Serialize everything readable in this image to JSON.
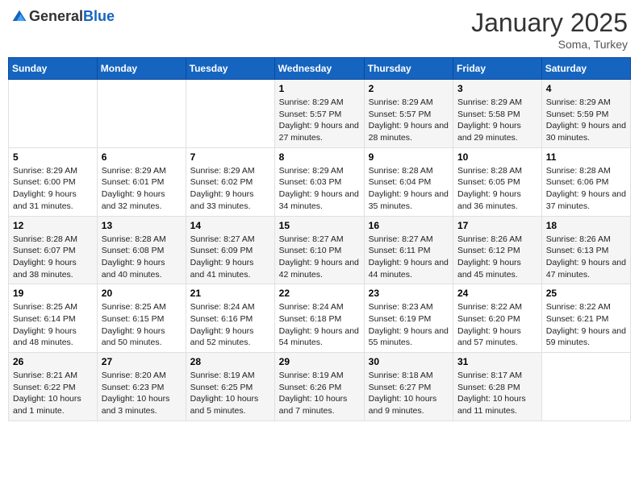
{
  "header": {
    "logo_general": "General",
    "logo_blue": "Blue",
    "month": "January 2025",
    "location": "Soma, Turkey"
  },
  "weekdays": [
    "Sunday",
    "Monday",
    "Tuesday",
    "Wednesday",
    "Thursday",
    "Friday",
    "Saturday"
  ],
  "weeks": [
    [
      {
        "day": "",
        "info": ""
      },
      {
        "day": "",
        "info": ""
      },
      {
        "day": "",
        "info": ""
      },
      {
        "day": "1",
        "info": "Sunrise: 8:29 AM\nSunset: 5:57 PM\nDaylight: 9 hours and 27 minutes."
      },
      {
        "day": "2",
        "info": "Sunrise: 8:29 AM\nSunset: 5:57 PM\nDaylight: 9 hours and 28 minutes."
      },
      {
        "day": "3",
        "info": "Sunrise: 8:29 AM\nSunset: 5:58 PM\nDaylight: 9 hours and 29 minutes."
      },
      {
        "day": "4",
        "info": "Sunrise: 8:29 AM\nSunset: 5:59 PM\nDaylight: 9 hours and 30 minutes."
      }
    ],
    [
      {
        "day": "5",
        "info": "Sunrise: 8:29 AM\nSunset: 6:00 PM\nDaylight: 9 hours and 31 minutes."
      },
      {
        "day": "6",
        "info": "Sunrise: 8:29 AM\nSunset: 6:01 PM\nDaylight: 9 hours and 32 minutes."
      },
      {
        "day": "7",
        "info": "Sunrise: 8:29 AM\nSunset: 6:02 PM\nDaylight: 9 hours and 33 minutes."
      },
      {
        "day": "8",
        "info": "Sunrise: 8:29 AM\nSunset: 6:03 PM\nDaylight: 9 hours and 34 minutes."
      },
      {
        "day": "9",
        "info": "Sunrise: 8:28 AM\nSunset: 6:04 PM\nDaylight: 9 hours and 35 minutes."
      },
      {
        "day": "10",
        "info": "Sunrise: 8:28 AM\nSunset: 6:05 PM\nDaylight: 9 hours and 36 minutes."
      },
      {
        "day": "11",
        "info": "Sunrise: 8:28 AM\nSunset: 6:06 PM\nDaylight: 9 hours and 37 minutes."
      }
    ],
    [
      {
        "day": "12",
        "info": "Sunrise: 8:28 AM\nSunset: 6:07 PM\nDaylight: 9 hours and 38 minutes."
      },
      {
        "day": "13",
        "info": "Sunrise: 8:28 AM\nSunset: 6:08 PM\nDaylight: 9 hours and 40 minutes."
      },
      {
        "day": "14",
        "info": "Sunrise: 8:27 AM\nSunset: 6:09 PM\nDaylight: 9 hours and 41 minutes."
      },
      {
        "day": "15",
        "info": "Sunrise: 8:27 AM\nSunset: 6:10 PM\nDaylight: 9 hours and 42 minutes."
      },
      {
        "day": "16",
        "info": "Sunrise: 8:27 AM\nSunset: 6:11 PM\nDaylight: 9 hours and 44 minutes."
      },
      {
        "day": "17",
        "info": "Sunrise: 8:26 AM\nSunset: 6:12 PM\nDaylight: 9 hours and 45 minutes."
      },
      {
        "day": "18",
        "info": "Sunrise: 8:26 AM\nSunset: 6:13 PM\nDaylight: 9 hours and 47 minutes."
      }
    ],
    [
      {
        "day": "19",
        "info": "Sunrise: 8:25 AM\nSunset: 6:14 PM\nDaylight: 9 hours and 48 minutes."
      },
      {
        "day": "20",
        "info": "Sunrise: 8:25 AM\nSunset: 6:15 PM\nDaylight: 9 hours and 50 minutes."
      },
      {
        "day": "21",
        "info": "Sunrise: 8:24 AM\nSunset: 6:16 PM\nDaylight: 9 hours and 52 minutes."
      },
      {
        "day": "22",
        "info": "Sunrise: 8:24 AM\nSunset: 6:18 PM\nDaylight: 9 hours and 54 minutes."
      },
      {
        "day": "23",
        "info": "Sunrise: 8:23 AM\nSunset: 6:19 PM\nDaylight: 9 hours and 55 minutes."
      },
      {
        "day": "24",
        "info": "Sunrise: 8:22 AM\nSunset: 6:20 PM\nDaylight: 9 hours and 57 minutes."
      },
      {
        "day": "25",
        "info": "Sunrise: 8:22 AM\nSunset: 6:21 PM\nDaylight: 9 hours and 59 minutes."
      }
    ],
    [
      {
        "day": "26",
        "info": "Sunrise: 8:21 AM\nSunset: 6:22 PM\nDaylight: 10 hours and 1 minute."
      },
      {
        "day": "27",
        "info": "Sunrise: 8:20 AM\nSunset: 6:23 PM\nDaylight: 10 hours and 3 minutes."
      },
      {
        "day": "28",
        "info": "Sunrise: 8:19 AM\nSunset: 6:25 PM\nDaylight: 10 hours and 5 minutes."
      },
      {
        "day": "29",
        "info": "Sunrise: 8:19 AM\nSunset: 6:26 PM\nDaylight: 10 hours and 7 minutes."
      },
      {
        "day": "30",
        "info": "Sunrise: 8:18 AM\nSunset: 6:27 PM\nDaylight: 10 hours and 9 minutes."
      },
      {
        "day": "31",
        "info": "Sunrise: 8:17 AM\nSunset: 6:28 PM\nDaylight: 10 hours and 11 minutes."
      },
      {
        "day": "",
        "info": ""
      }
    ]
  ]
}
